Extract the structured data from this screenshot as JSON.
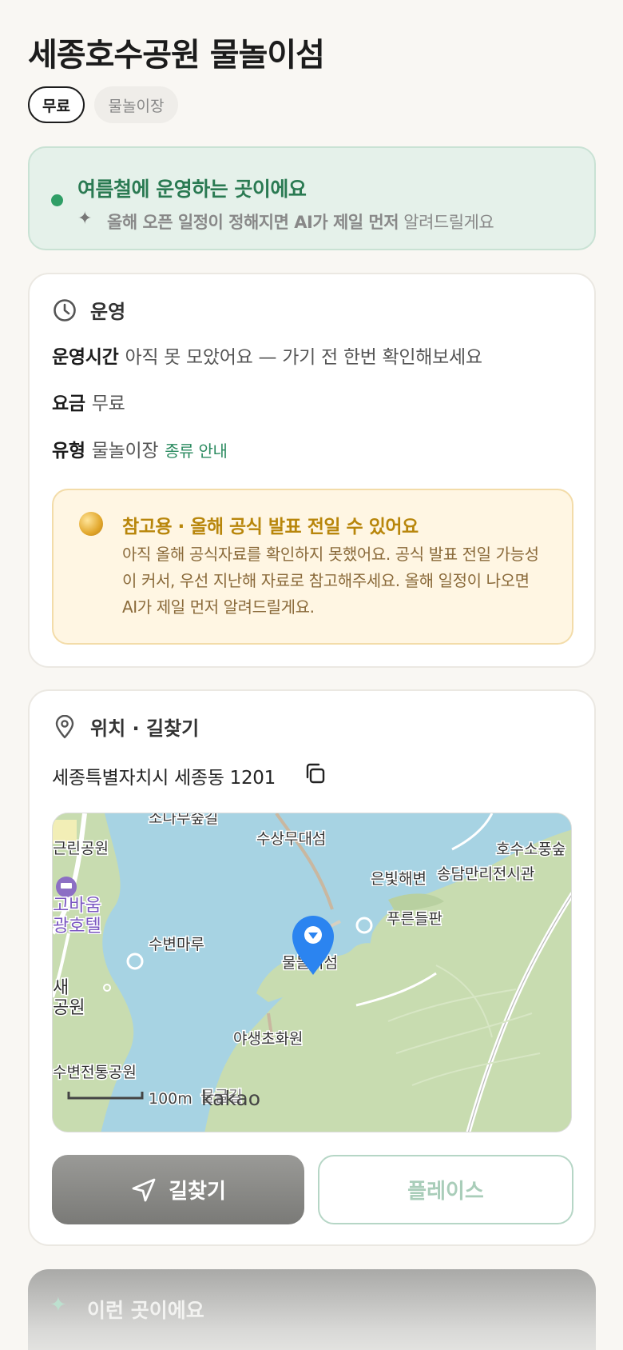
{
  "place": {
    "title": "세종호수공원 물놀이섬",
    "chips": {
      "price": "무료",
      "type": "물놀이장"
    }
  },
  "season_notice": {
    "title": "여름철에 운영하는 곳이에요",
    "subtitle_bold": "올해 오픈 일정이 정해지면 AI가 제일 먼저",
    "subtitle_rest": "알려드릴게요",
    "icon": "sparkle-icon",
    "accent_color": "#2f9e66"
  },
  "operation": {
    "section_title": "운영",
    "hours_label": "운영시간",
    "hours_value": "아직 못 모았어요 — 가기 전 한번 확인해보세요",
    "fee_label": "요금",
    "fee_value": "무료",
    "type_label": "유형",
    "type_value": "물놀이장",
    "type_link": "종류 안내",
    "notice": {
      "title": "참고용 · 올해 공식 발표 전일 수 있어요",
      "body": "아직 올해 공식자료를 확인하지 못했어요. 공식 발표 전일 가능성이 커서, 우선 지난해 자료로 참고해주세요. 올해 일정이 나오면 AI가 제일 먼저 알려드릴게요."
    }
  },
  "location": {
    "section_title": "위치 · 길찾기",
    "address": "세종특별자치시 세종동 1201",
    "map": {
      "labels": {
        "sonamu": "소나무숲길",
        "geunlin": "근린공원",
        "susang": "수상무대섬",
        "hosu": "호수소풍숲",
        "eunbit": "은빛해변",
        "songdam": "송담만리전시관",
        "hotel_1": "고바움",
        "hotel_2": "광호텔",
        "pureun": "푸른들판",
        "subyeon": "수변마루",
        "marker": "물놀이섬",
        "sae_1": "새",
        "sae_2": "공원",
        "yasaeng": "야생초화원",
        "jeontong": "수변전통공원",
        "mulgeul": "물굴길"
      },
      "scale": "100m",
      "brand": "kakao"
    },
    "route_button": "길찾기",
    "place_button": "플레이스"
  },
  "next_section": {
    "title": "이런 곳이에요"
  }
}
